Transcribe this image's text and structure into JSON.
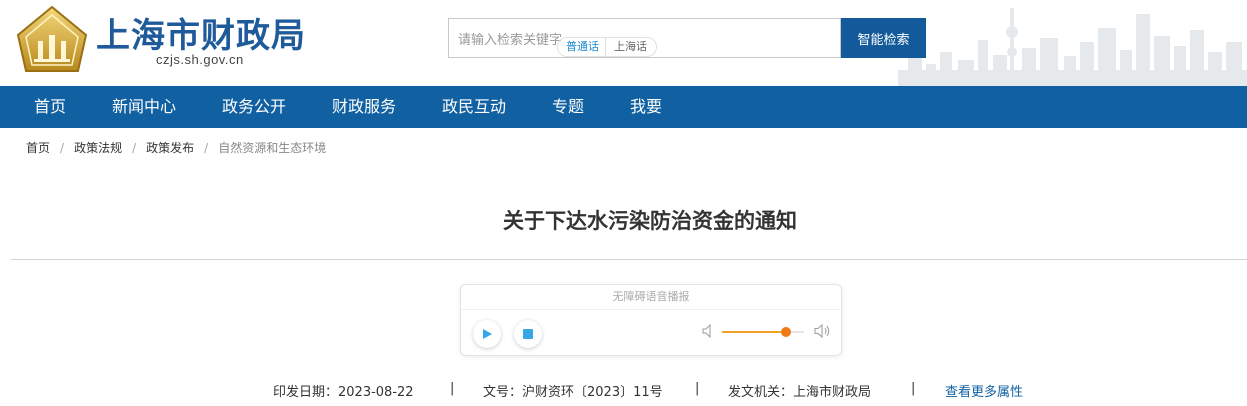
{
  "header": {
    "site_title": "上海市财政局",
    "site_domain": "czjs.sh.gov.cn",
    "search_placeholder": "请输入检索关键字",
    "search_button": "智能检索"
  },
  "nav": {
    "items": [
      "首页",
      "新闻中心",
      "政务公开",
      "财政服务",
      "政民互动",
      "专题",
      "我要"
    ]
  },
  "breadcrumb": {
    "items": [
      "首页",
      "政策法规",
      "政策发布",
      "自然资源和生态环境"
    ],
    "separator": "/"
  },
  "article": {
    "title": "关于下达水污染防治资金的通知"
  },
  "player": {
    "header": "无障碍语音播报",
    "lang_mandarin": "普通话",
    "lang_shanghai": "上海话",
    "volume_fraction": 0.78
  },
  "meta": {
    "date_label": "印发日期：",
    "date_value": "2023-08-22",
    "doc_label": "文号：",
    "doc_value": "沪财资环〔2023〕11号",
    "issuer_label": "发文机关：",
    "issuer_value": "上海市财政局",
    "separator": "|",
    "more_link": "查看更多属性"
  },
  "colors": {
    "brand_blue": "#1160a2",
    "button_blue": "#135a9a",
    "title_blue": "#1f5a9a",
    "volume_orange": "#f07a17"
  }
}
